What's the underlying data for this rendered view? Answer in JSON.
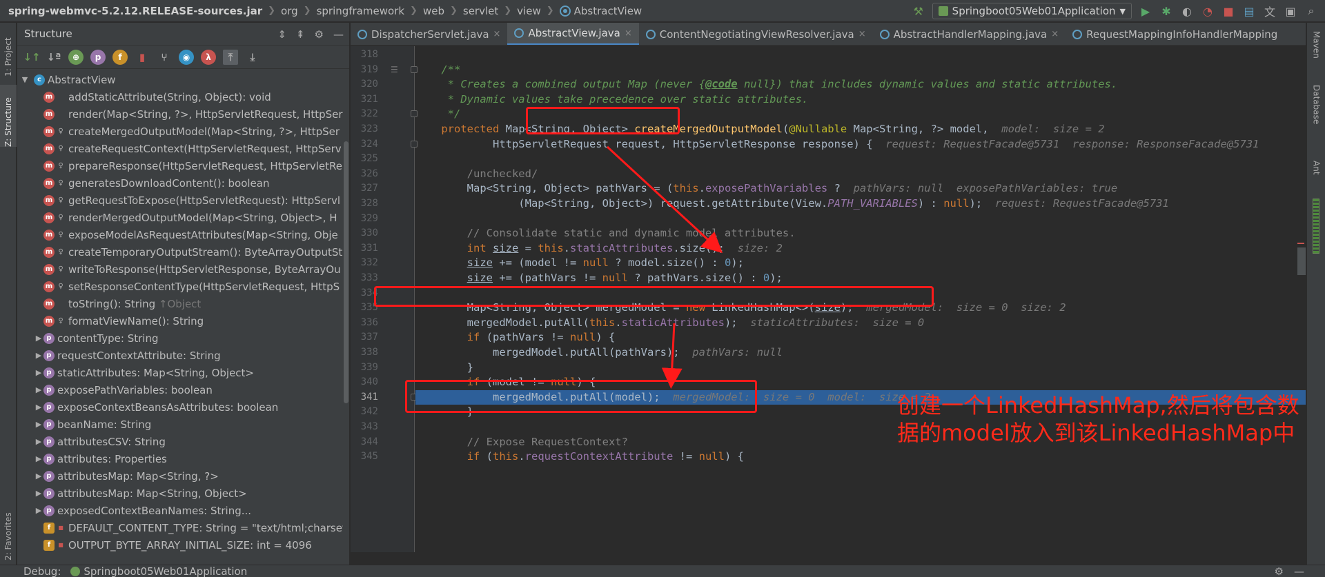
{
  "breadcrumbs": [
    "spring-webmvc-5.2.12.RELEASE-sources.jar",
    "org",
    "springframework",
    "web",
    "servlet",
    "view",
    "AbstractView"
  ],
  "toolbar": {
    "run_config": "Springboot05Web01Application",
    "icons": [
      "hammer-icon",
      "run-icon",
      "debug-icon",
      "coverage-icon",
      "profile-icon",
      "stop-icon",
      "project-structure-icon",
      "translate-icon",
      "terminal-icon",
      "search-icon"
    ]
  },
  "left_strip": {
    "project_tab": "1: Project",
    "structure_tab": "Z: Structure",
    "favorites_tab": "2: Favorites"
  },
  "right_strip": {
    "maven_tab": "Maven",
    "database_tab": "Database",
    "ant_tab": "Ant"
  },
  "structure": {
    "title": "Structure",
    "root": "AbstractView",
    "items": [
      {
        "kind": "m",
        "vis": "",
        "label": "addStaticAttribute(String, Object): void",
        "expand": false
      },
      {
        "kind": "m",
        "vis": "",
        "label": "render(Map<String, ?>, HttpServletRequest, HttpSer",
        "expand": false
      },
      {
        "kind": "m",
        "vis": "p",
        "label": "createMergedOutputModel(Map<String, ?>, HttpSer",
        "expand": false
      },
      {
        "kind": "m",
        "vis": "p",
        "label": "createRequestContext(HttpServletRequest, HttpServ",
        "expand": false
      },
      {
        "kind": "m",
        "vis": "p",
        "label": "prepareResponse(HttpServletRequest, HttpServletRe",
        "expand": false
      },
      {
        "kind": "m",
        "vis": "p",
        "label": "generatesDownloadContent(): boolean",
        "expand": false
      },
      {
        "kind": "m",
        "vis": "p",
        "label": "getRequestToExpose(HttpServletRequest): HttpServl",
        "expand": false
      },
      {
        "kind": "m",
        "vis": "p",
        "label": "renderMergedOutputModel(Map<String, Object>, H",
        "expand": false
      },
      {
        "kind": "m",
        "vis": "p",
        "label": "exposeModelAsRequestAttributes(Map<String, Obje",
        "expand": false
      },
      {
        "kind": "m",
        "vis": "p",
        "label": "createTemporaryOutputStream(): ByteArrayOutputSt",
        "expand": false
      },
      {
        "kind": "m",
        "vis": "p",
        "label": "writeToResponse(HttpServletResponse, ByteArrayOu",
        "expand": false
      },
      {
        "kind": "m",
        "vis": "p",
        "label": "setResponseContentType(HttpServletRequest, HttpS",
        "expand": false
      },
      {
        "kind": "m",
        "vis": "",
        "label": "toString(): String",
        "suffix": " ↑Object",
        "expand": false
      },
      {
        "kind": "m",
        "vis": "p",
        "label": "formatViewName(): String",
        "expand": false
      },
      {
        "kind": "p",
        "vis": "",
        "label": "contentType: String",
        "expand": true
      },
      {
        "kind": "p",
        "vis": "",
        "label": "requestContextAttribute: String",
        "expand": true
      },
      {
        "kind": "p",
        "vis": "",
        "label": "staticAttributes: Map<String, Object>",
        "expand": true
      },
      {
        "kind": "p",
        "vis": "",
        "label": "exposePathVariables: boolean",
        "expand": true
      },
      {
        "kind": "p",
        "vis": "",
        "label": "exposeContextBeansAsAttributes: boolean",
        "expand": true
      },
      {
        "kind": "p",
        "vis": "",
        "label": "beanName: String",
        "expand": true
      },
      {
        "kind": "p",
        "vis": "",
        "label": "attributesCSV: String",
        "expand": true
      },
      {
        "kind": "p",
        "vis": "",
        "label": "attributes: Properties",
        "expand": true
      },
      {
        "kind": "p",
        "vis": "",
        "label": "attributesMap: Map<String, ?>",
        "expand": true
      },
      {
        "kind": "p",
        "vis": "",
        "label": "attributesMap: Map<String, Object>",
        "expand": true
      },
      {
        "kind": "p",
        "vis": "",
        "label": "exposedContextBeanNames: String...",
        "expand": true
      },
      {
        "kind": "f",
        "vis": "l",
        "label": "DEFAULT_CONTENT_TYPE: String = \"text/html;charset",
        "expand": false
      },
      {
        "kind": "f",
        "vis": "l",
        "label": "OUTPUT_BYTE_ARRAY_INITIAL_SIZE: int = 4096",
        "expand": false
      }
    ]
  },
  "tabs": [
    {
      "label": "DispatcherServlet.java",
      "active": false
    },
    {
      "label": "AbstractView.java",
      "active": true
    },
    {
      "label": "ContentNegotiatingViewResolver.java",
      "active": false
    },
    {
      "label": "AbstractHandlerMapping.java",
      "active": false
    },
    {
      "label": "RequestMappingInfoHandlerMapping",
      "active": false
    }
  ],
  "editor": {
    "first_line": 318,
    "current_line": 341,
    "lines": [
      {
        "n": 318,
        "html": ""
      },
      {
        "n": 319,
        "html": "    <span class=\"doc\">/**</span>"
      },
      {
        "n": 320,
        "html": "    <span class=\"doc\"> * Creates a combined output Map (never {</span><span class=\"doctag\">@code</span><span class=\"doc\"> null}) that includes dynamic values and static attributes.</span>"
      },
      {
        "n": 321,
        "html": "    <span class=\"doc\"> * Dynamic values take precedence over static attributes.</span>"
      },
      {
        "n": 322,
        "html": "    <span class=\"doc\"> */</span>"
      },
      {
        "n": 323,
        "html": "    <span class=\"kw\">protected</span> Map&lt;String, Object&gt; <span class=\"fn\">createMergedOutputModel</span>(<span class=\"ann\">@Nullable</span> Map&lt;String, ?&gt; model,  <span class=\"hint\">model:  size = 2</span>"
      },
      {
        "n": 324,
        "html": "            HttpServletRequest request, HttpServletResponse response) {  <span class=\"hint\">request: RequestFacade@5731  response: ResponseFacade@5731</span>"
      },
      {
        "n": 325,
        "html": ""
      },
      {
        "n": 326,
        "html": "        <span class=\"cmt\">/unchecked/</span>"
      },
      {
        "n": 327,
        "html": "        Map&lt;String, Object&gt; pathVars = (<span class=\"kw\">this</span>.<span class=\"fld\">exposePathVariables</span> ?  <span class=\"hint\">pathVars: null  exposePathVariables: true</span>"
      },
      {
        "n": 328,
        "html": "                (Map&lt;String, Object&gt;) request.getAttribute(View.<span class=\"stat\">PATH_VARIABLES</span>) : <span class=\"kw\">null</span>);  <span class=\"hint\">request: RequestFacade@5731</span>"
      },
      {
        "n": 329,
        "html": ""
      },
      {
        "n": 330,
        "html": "        <span class=\"cmt\">// Consolidate static and dynamic model attributes.</span>"
      },
      {
        "n": 331,
        "html": "        <span class=\"kw\">int</span> <span class=\"ul\">size</span> = <span class=\"kw\">this</span>.<span class=\"fld\">staticAttributes</span>.size();  <span class=\"hint\">size: 2</span>"
      },
      {
        "n": 332,
        "html": "        <span class=\"ul\">size</span> += (model != <span class=\"kw\">null</span> ? model.size() : <span class=\"num\">0</span>);"
      },
      {
        "n": 333,
        "html": "        <span class=\"ul\">size</span> += (pathVars != <span class=\"kw\">null</span> ? pathVars.size() : <span class=\"num\">0</span>);"
      },
      {
        "n": 334,
        "html": ""
      },
      {
        "n": 335,
        "html": "        Map&lt;String, Object&gt; mergedModel = <span class=\"kw\">new</span> LinkedHashMap&lt;&gt;(<span class=\"ul\">size</span>);  <span class=\"hint\">mergedModel:  size = 0  size: 2</span>"
      },
      {
        "n": 336,
        "html": "        mergedModel.putAll(<span class=\"kw\">this</span>.<span class=\"fld\">staticAttributes</span>);  <span class=\"hint\">staticAttributes:  size = 0</span>"
      },
      {
        "n": 337,
        "html": "        <span class=\"kw\">if</span> (pathVars != <span class=\"kw\">null</span>) {"
      },
      {
        "n": 338,
        "html": "            mergedModel.putAll(pathVars);  <span class=\"hint\">pathVars: null</span>"
      },
      {
        "n": 339,
        "html": "        }"
      },
      {
        "n": 340,
        "html": "        <span class=\"kw\">if</span> (model != <span class=\"kw\">null</span>) {"
      },
      {
        "n": 341,
        "html": "            mergedModel.putAll(model);  <span class=\"hint\">mergedModel:  size = 0  model:  size = 2</span>"
      },
      {
        "n": 342,
        "html": "        }"
      },
      {
        "n": 343,
        "html": ""
      },
      {
        "n": 344,
        "html": "        <span class=\"cmt\">// Expose RequestContext?</span>"
      },
      {
        "n": 345,
        "html": "        <span class=\"kw\">if</span> (<span class=\"kw\">this</span>.<span class=\"fld\">requestContextAttribute</span> != <span class=\"kw\">null</span>) {"
      }
    ]
  },
  "annotation": {
    "text": "创建一个LinkedHashMap,然后将包含数据的model放入到该LinkedHashMap中",
    "color": "#ff2a1a"
  },
  "bottom": {
    "debug_label": "Debug:",
    "session_label": "Springboot05Web01Application"
  },
  "colors": {
    "accent": "#4a88c7",
    "current_line": "#2d5f99",
    "annotation_red": "#ff1a1a"
  }
}
